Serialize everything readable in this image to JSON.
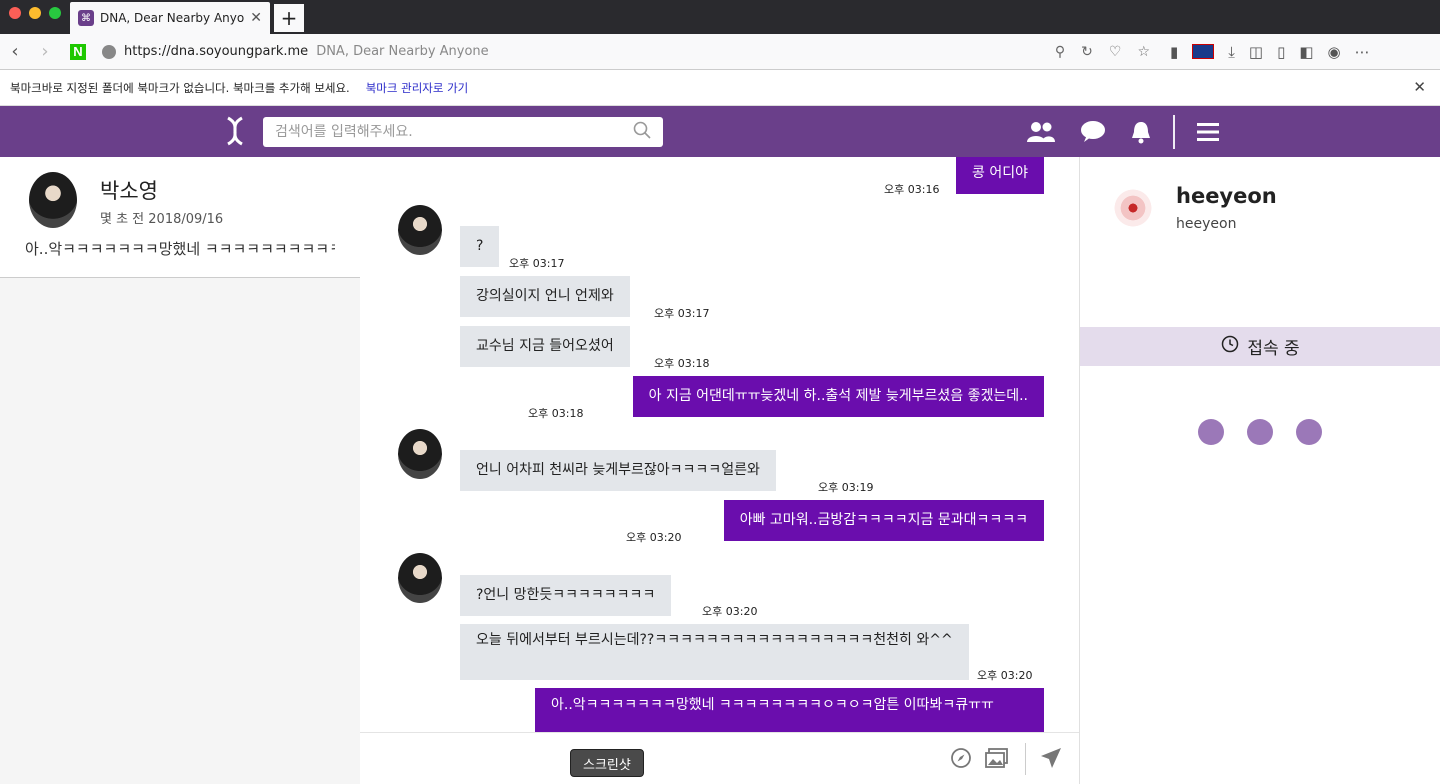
{
  "browser": {
    "tab_title": "DNA, Dear Nearby Anyone",
    "tab_close": "✕",
    "new_tab": "+",
    "url": "https://dna.soyoungpark.me",
    "url_page_title": "DNA, Dear Nearby Anyone",
    "naver_label": "N",
    "bookmark_message": "북마크바로 지정된 폴더에 북마크가 없습니다. 북마크를 추가해 보세요.",
    "bookmark_link": "북마크 관리자로 가기",
    "bookmark_close": "✕"
  },
  "header": {
    "search_placeholder": "검색어를 입력해주세요.",
    "brand_color": "#6a3f8a"
  },
  "conversation": {
    "name": "박소영",
    "time": "몇 초 전  2018/09/16",
    "last_message": "아..악ㅋㅋㅋㅋㅋㅋㅋ망했네 ㅋㅋㅋㅋㅋㅋㅋㅋㅋㅋㅇㅋㅇㅋ암튼 이따봐ㅋ큐ㅠㅠ"
  },
  "messages": [
    {
      "dir": "out",
      "text": "콩 어디야",
      "time": "오후 03:16"
    },
    {
      "dir": "in",
      "text": "?",
      "time": "오후 03:17"
    },
    {
      "dir": "in",
      "text": "강의실이지 언니 언제와",
      "time": "오후 03:17"
    },
    {
      "dir": "in",
      "text": "교수님 지금 들어오셨어",
      "time": "오후 03:18"
    },
    {
      "dir": "out",
      "text": "아 지금 어댄데ㅠㅠ늦겠네 하..출석 제발 늦게부르셨음 좋겠는데..",
      "time": "오후 03:18"
    },
    {
      "dir": "in",
      "text": "언니 어차피 천씨라 늦게부르잖아ㅋㅋㅋㅋ얼른와",
      "time": "오후 03:19"
    },
    {
      "dir": "out",
      "text": "아빠 고마워..금방감ㅋㅋㅋㅋ지금 문과대ㅋㅋㅋㅋ",
      "time": "오후 03:20"
    },
    {
      "dir": "in",
      "text": "?언니 망한듯ㅋㅋㅋㅋㅋㅋㅋㅋ",
      "time": "오후 03:20"
    },
    {
      "dir": "in",
      "text": "오늘 뒤에서부터 부르시는데??ㅋㅋㅋㅋㅋㅋㅋㅋㅋㅋㅋㅋㅋㅋㅋㅋㅋ천천히 와^^",
      "time": "오후 03:20"
    },
    {
      "dir": "out",
      "text": "아..악ㅋㅋㅋㅋㅋㅋㅋ망했네 ㅋㅋㅋㅋㅋㅋㅋㅋㅇㅋㅇㅋ암튼 이따봐ㅋ큐ㅠㅠ",
      "time": ""
    }
  ],
  "composer": {
    "tooltip": "스크린샷"
  },
  "profile": {
    "name": "heeyeon",
    "sub": "heeyeon",
    "status": "접속 중",
    "dot_color": "#9b78b8"
  }
}
